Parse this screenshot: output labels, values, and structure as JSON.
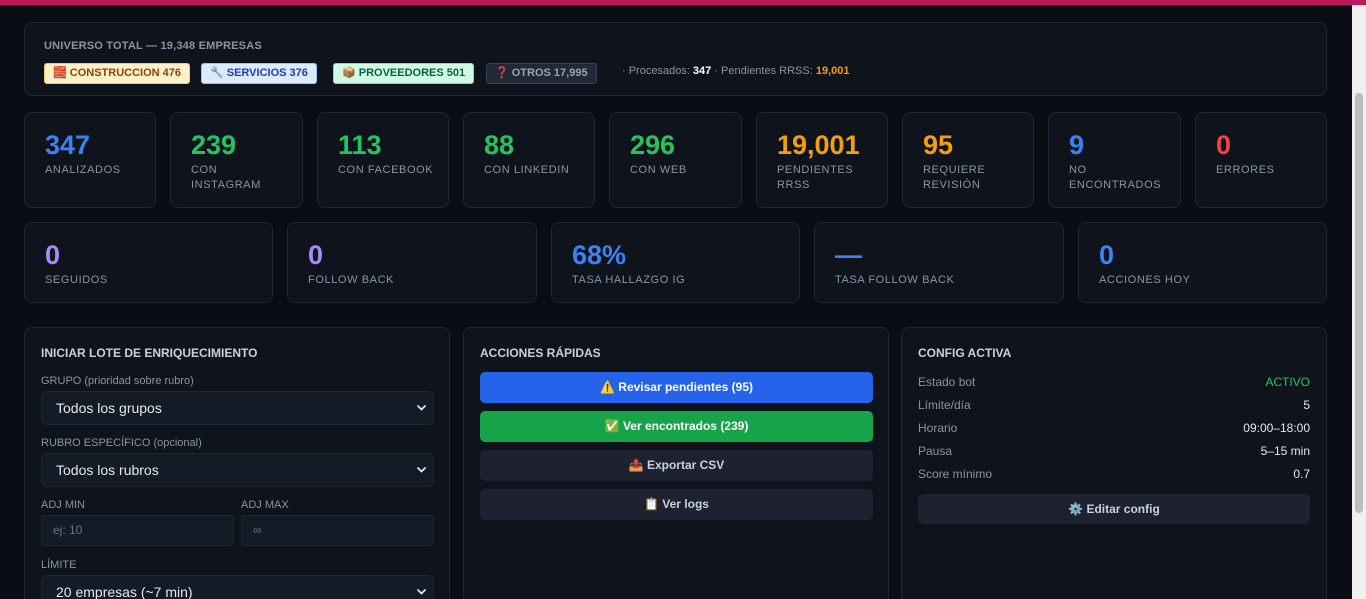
{
  "universe": {
    "title": "UNIVERSO TOTAL — 19,348 EMPRESAS",
    "badges": {
      "construccion": "🧱 CONSTRUCCION 476",
      "servicios": "🔧 SERVICIOS 376",
      "proveedores": "📦 PROVEEDORES 501",
      "otros": "❓ OTROS 17,995"
    },
    "processed_prefix": "· Procesados: ",
    "processed_value": "347",
    "pending_prefix": " · Pendientes RRSS: ",
    "pending_value": "19,001"
  },
  "stats": [
    {
      "value": "347",
      "label": "ANALIZADOS"
    },
    {
      "value": "239",
      "label": "CON INSTAGRAM"
    },
    {
      "value": "113",
      "label": "CON FACEBOOK"
    },
    {
      "value": "88",
      "label": "CON LINKEDIN"
    },
    {
      "value": "296",
      "label": "CON WEB"
    },
    {
      "value": "19,001",
      "label": "PENDIENTES RRSS"
    },
    {
      "value": "95",
      "label": "REQUIERE REVISIÓN"
    },
    {
      "value": "9",
      "label": "NO ENCONTRADOS"
    },
    {
      "value": "0",
      "label": "ERRORES"
    }
  ],
  "stats2": [
    {
      "value": "0",
      "label": "SEGUIDOS"
    },
    {
      "value": "0",
      "label": "FOLLOW BACK"
    },
    {
      "value": "68%",
      "label": "TASA HALLAZGO IG"
    },
    {
      "value": "—",
      "label": "TASA FOLLOW BACK"
    },
    {
      "value": "0",
      "label": "ACCIONES HOY"
    }
  ],
  "enrich": {
    "title": "INICIAR LOTE DE ENRIQUECIMIENTO",
    "grupo_label": "GRUPO (prioridad sobre rubro)",
    "grupo_value": "Todos los grupos",
    "rubro_label": "RUBRO ESPECÍFICO (opcional)",
    "rubro_value": "Todos los rubros",
    "adj_min_label": "ADJ MIN",
    "adj_min_placeholder": "ej: 10",
    "adj_max_label": "ADJ MAX",
    "adj_max_placeholder": "∞",
    "limite_label": "LÍMITE",
    "limite_value": "20 empresas (~7 min)"
  },
  "actions": {
    "title": "ACCIONES RÁPIDAS",
    "revisar": "⚠️ Revisar pendientes (95)",
    "encontrados": "✅ Ver encontrados (239)",
    "exportar": "📤 Exportar CSV",
    "logs": "📋 Ver logs"
  },
  "config": {
    "title": "CONFIG ACTIVA",
    "rows": [
      {
        "key": "Estado bot",
        "value": "ACTIVO"
      },
      {
        "key": "Límite/día",
        "value": "5"
      },
      {
        "key": "Horario",
        "value": "09:00–18:00"
      },
      {
        "key": "Pausa",
        "value": "5–15 min"
      },
      {
        "key": "Score mínimo",
        "value": "0.7"
      }
    ],
    "edit": "⚙️ Editar config"
  },
  "colors": {
    "accent_blue": "#3b82f6",
    "accent_green": "#22c55e",
    "accent_orange": "#f59e0b",
    "accent_red": "#ef4444",
    "accent_purple": "#a78bfa",
    "top_bar": "#be185d"
  }
}
